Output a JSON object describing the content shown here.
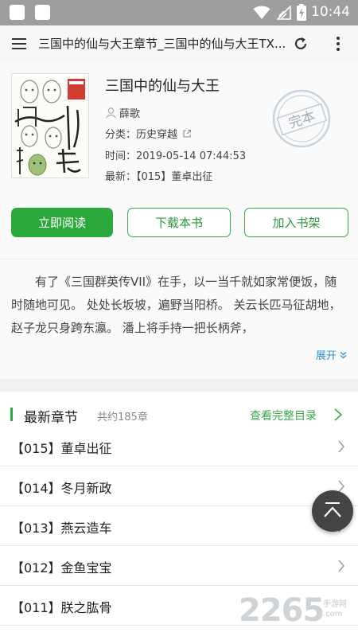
{
  "status_bar": {
    "time": "10:44"
  },
  "app_bar": {
    "title": "三国中的仙与大王章节_三国中的仙与大王TX...",
    "menu_icon": "menu-icon",
    "refresh_icon": "refresh-icon",
    "more_icon": "more-vert-icon"
  },
  "book": {
    "title": "三国中的仙与大王",
    "author": "薛歌",
    "category_label": "分类：",
    "category": "历史穿越",
    "time_label": "时间：",
    "time": "2019-05-14 07:44:53",
    "latest_label": "最新：",
    "latest": "【015】董卓出征",
    "stamp_text": "完本",
    "cover_title": "三國中的仙与大王",
    "cover_author": "薛歌"
  },
  "actions": {
    "read": "立即阅读",
    "download": "下载本书",
    "shelf": "加入书架"
  },
  "description": {
    "text": "有了《三国群英传VII》在手，以一当千就如家常便饭，随时随地可见。 处处长坂坡，遍野当阳桥。 关云长匹马征胡地，赵子龙只身跨东瀛。 潘上将手持一把长柄斧，",
    "expand": "展开"
  },
  "chapters": {
    "title": "最新章节",
    "count": "共约185章",
    "view_all": "查看完整目录",
    "items": [
      {
        "label": "【015】董卓出征"
      },
      {
        "label": "【014】冬月新政"
      },
      {
        "label": "【013】燕云造车"
      },
      {
        "label": "【012】金鱼宝宝"
      },
      {
        "label": "【011】朕之肱骨"
      }
    ]
  },
  "watermark": {
    "number": "2265",
    "suffix": ".com",
    "sub": "手游网"
  },
  "colors": {
    "accent": "#2ba93d",
    "link": "#2a8fce",
    "statusbar": "#9e9e9e"
  }
}
